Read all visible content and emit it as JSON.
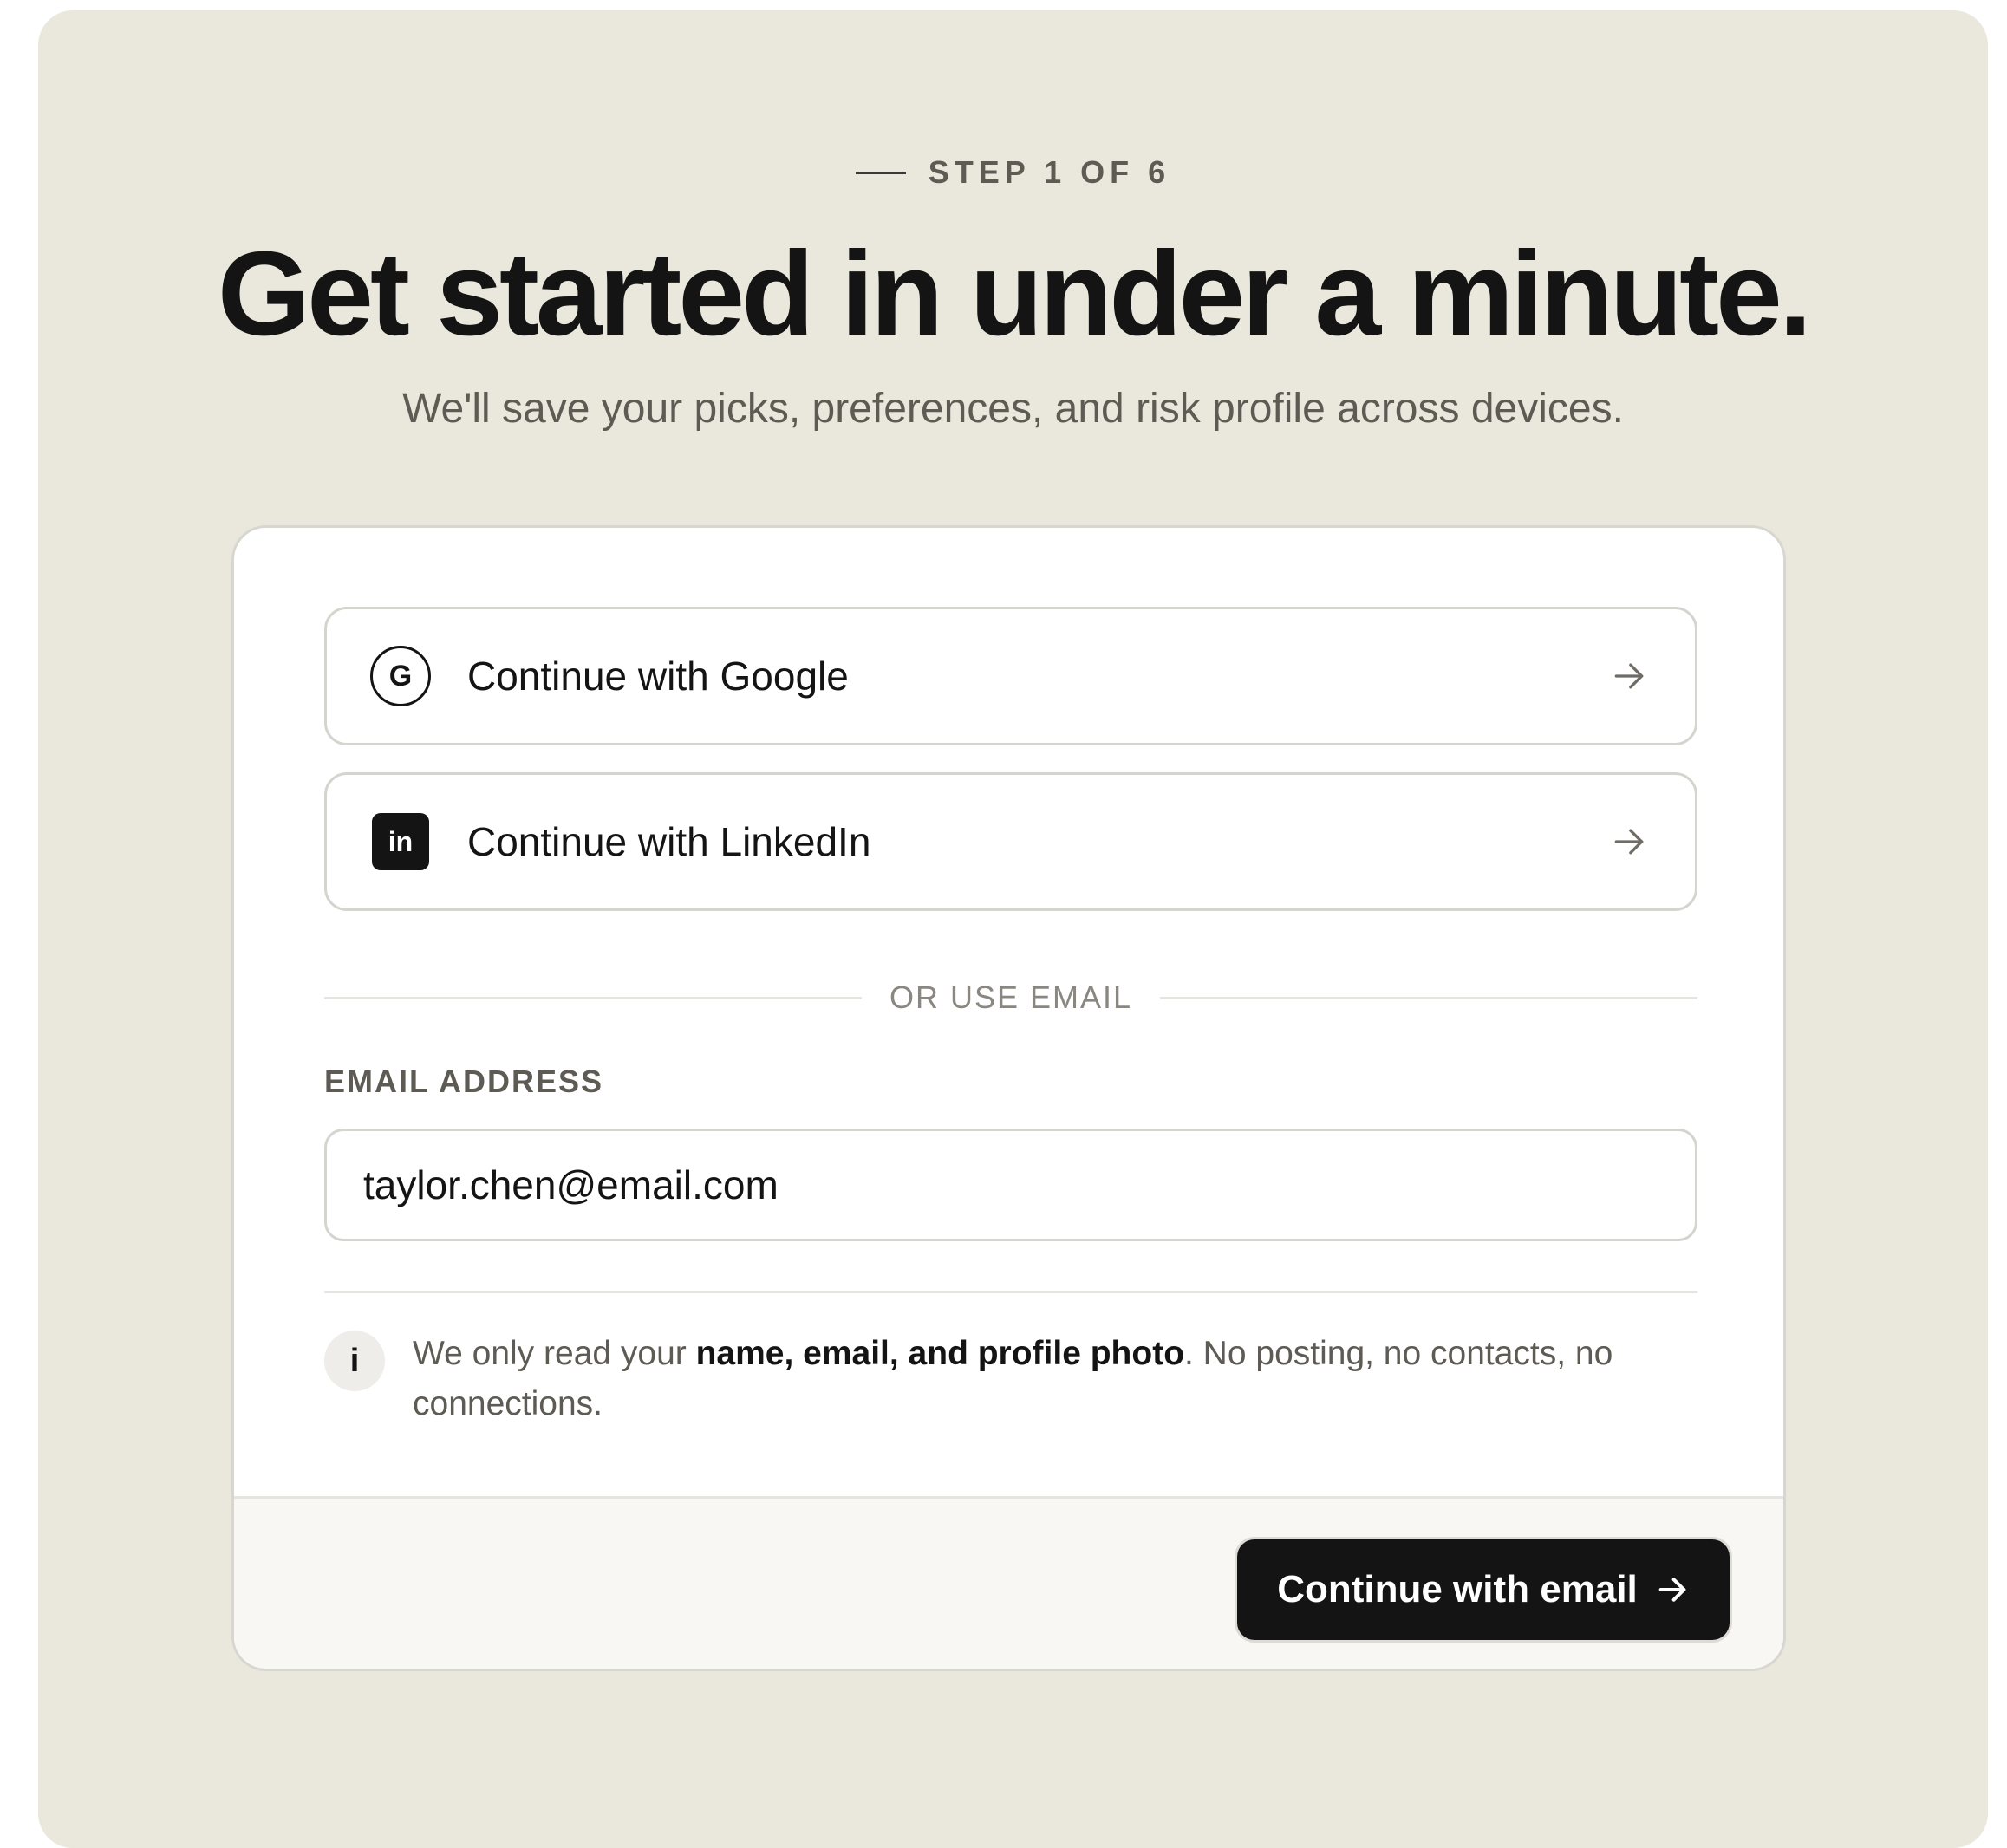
{
  "header": {
    "step": "STEP 1 OF 6",
    "title": "Get started in under a minute.",
    "subtitle": "We'll save your picks, preferences, and risk profile across devices."
  },
  "sso": [
    {
      "label": "Continue with Google",
      "icon": "google-icon",
      "glyph": "G"
    },
    {
      "label": "Continue with LinkedIn",
      "icon": "linkedin-icon",
      "glyph": "in"
    }
  ],
  "divider": {
    "text": "OR USE EMAIL"
  },
  "email": {
    "label": "EMAIL ADDRESS",
    "value": "taylor.chen@email.com"
  },
  "info": {
    "icon": "info-icon",
    "glyph": "i",
    "text_before": "We only read your ",
    "text_bold": "name, email, and profile photo",
    "text_after": ". No posting, no contacts, no connections."
  },
  "footer": {
    "primary_label": "Continue with email"
  },
  "colors": {
    "page_bg": "#eae7dc",
    "card_bg": "#ffffff",
    "footer_bg": "#f8f7f4",
    "primary_btn": "#141414",
    "text_primary": "#141414",
    "text_muted": "#5e5b55"
  }
}
